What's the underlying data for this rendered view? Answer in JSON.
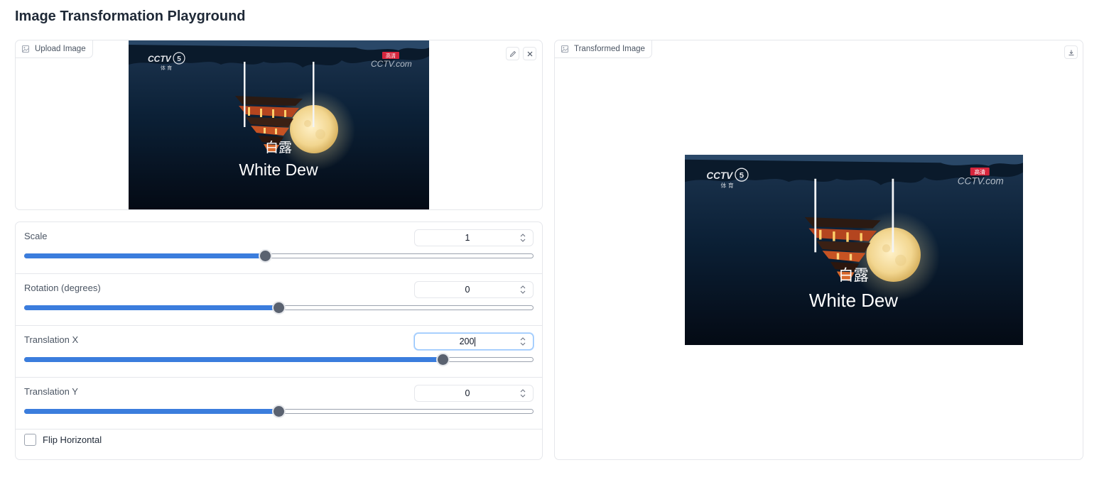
{
  "app": {
    "title": "Image Transformation Playground"
  },
  "upload": {
    "label": "Upload Image",
    "label_icon": "image-icon",
    "edit_icon": "pencil-icon",
    "clear_icon": "close-icon",
    "image_text": {
      "zh": "白露",
      "en": "White Dew",
      "logo_left": "CCTV",
      "logo_channel": "5",
      "logo_sub": "体 育",
      "logo_right": "CCTV.com",
      "logo_right_badge": "高清"
    }
  },
  "output": {
    "label": "Transformed Image",
    "label_icon": "image-icon",
    "download_icon": "download-icon"
  },
  "controls": {
    "sliders": [
      {
        "label": "Scale",
        "value": "1",
        "fraction": 0.474
      },
      {
        "label": "Rotation (degrees)",
        "value": "0",
        "fraction": 0.5
      },
      {
        "label": "Translation X",
        "value": "200",
        "fraction": 0.824,
        "focused": true
      },
      {
        "label": "Translation Y",
        "value": "0",
        "fraction": 0.5
      }
    ],
    "flip": {
      "label": "Flip Horizontal",
      "checked": false
    }
  },
  "colors": {
    "accent": "#3b7ddd",
    "thumb": "#5a6270",
    "border": "#e5e7eb"
  }
}
